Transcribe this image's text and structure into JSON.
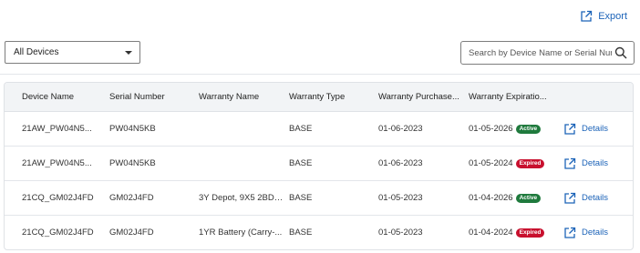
{
  "toolbar": {
    "export_label": "Export"
  },
  "filter": {
    "device_select": "All Devices"
  },
  "search": {
    "placeholder": "Search by Device Name or Serial Numb..."
  },
  "table": {
    "headers": [
      "Device Name",
      "Serial Number",
      "Warranty Name",
      "Warranty Type",
      "Warranty Purchase...",
      "Warranty Expiratio..."
    ],
    "rows": [
      {
        "device_name": "21AW_PW04N5...",
        "serial": "PW04N5KB",
        "warranty_name": "",
        "type": "BASE",
        "purchase": "01-06-2023",
        "expiration": "01-05-2026",
        "status": "Active",
        "details": "Details"
      },
      {
        "device_name": "21AW_PW04N5...",
        "serial": "PW04N5KB",
        "warranty_name": "",
        "type": "BASE",
        "purchase": "01-06-2023",
        "expiration": "01-05-2024",
        "status": "Expired",
        "details": "Details"
      },
      {
        "device_name": "21CQ_GM02J4FD",
        "serial": "GM02J4FD",
        "warranty_name": "3Y Depot, 9X5 2BD ...",
        "type": "BASE",
        "purchase": "01-05-2023",
        "expiration": "01-04-2026",
        "status": "Active",
        "details": "Details"
      },
      {
        "device_name": "21CQ_GM02J4FD",
        "serial": "GM02J4FD",
        "warranty_name": "1YR Battery (Carry-...",
        "type": "BASE",
        "purchase": "01-05-2023",
        "expiration": "01-04-2024",
        "status": "Expired",
        "details": "Details"
      }
    ]
  },
  "colors": {
    "link": "#1c63b8",
    "active": "#1f7a3d",
    "expired": "#c8102e"
  },
  "icons": {
    "export": "external-link-icon",
    "search": "search-icon",
    "details": "external-link-icon",
    "select": "chevron-down-icon"
  }
}
